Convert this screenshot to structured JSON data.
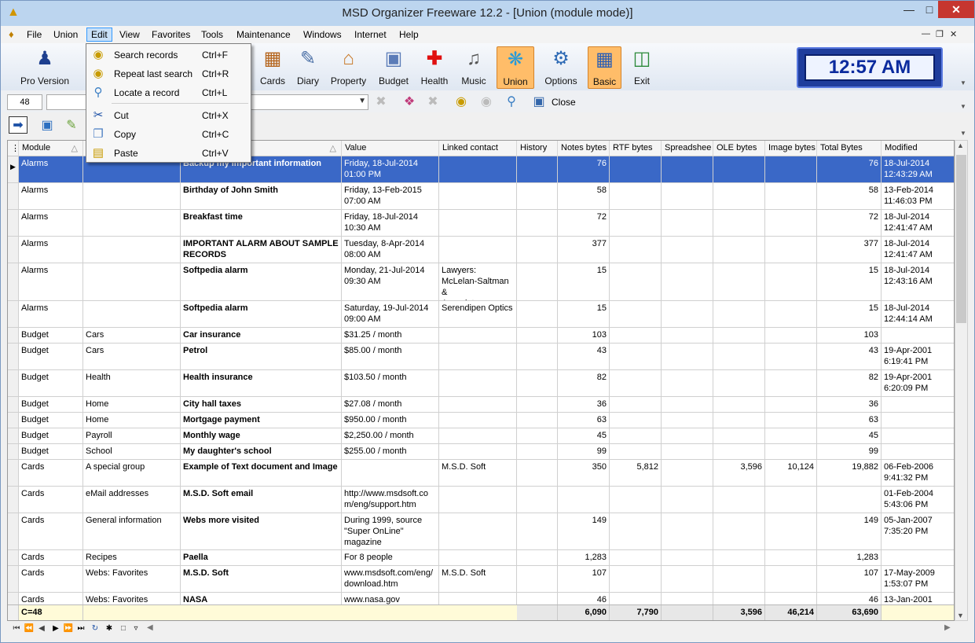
{
  "window": {
    "title": "MSD Organizer Freeware 12.2 - [Union (module mode)]"
  },
  "menu": [
    "File",
    "Union",
    "Edit",
    "View",
    "Favorites",
    "Tools",
    "Maintenance",
    "Windows",
    "Internet",
    "Help"
  ],
  "toolbar": {
    "buttons": [
      {
        "label": "Pro Version",
        "icon": "shield-person-icon"
      },
      {
        "label": "Cards",
        "icon": "cards-icon"
      },
      {
        "label": "Diary",
        "icon": "diary-icon"
      },
      {
        "label": "Property",
        "icon": "house-icon"
      },
      {
        "label": "Budget",
        "icon": "calculator-icon"
      },
      {
        "label": "Health",
        "icon": "cross-icon"
      },
      {
        "label": "Music",
        "icon": "cd-icon"
      },
      {
        "label": "Union",
        "icon": "puzzle-icon"
      },
      {
        "label": "Options",
        "icon": "gear-icon"
      },
      {
        "label": "Basic",
        "icon": "window-icon"
      },
      {
        "label": "Exit",
        "icon": "door-icon"
      }
    ],
    "clock": "12:57 AM"
  },
  "searchbar": {
    "record_count": "48",
    "close_label": "Close"
  },
  "edit_menu": [
    {
      "label": "Search records",
      "shortcut": "Ctrl+F",
      "icon": "binoculars-icon"
    },
    {
      "label": "Repeat last search",
      "shortcut": "Ctrl+R",
      "icon": "binoculars-icon"
    },
    {
      "label": "Locate a record",
      "shortcut": "Ctrl+L",
      "icon": "magnifier-icon"
    },
    {
      "label": "Cut",
      "shortcut": "Ctrl+X",
      "icon": "scissors-icon"
    },
    {
      "label": "Copy",
      "shortcut": "Ctrl+C",
      "icon": "copy-icon"
    },
    {
      "label": "Paste",
      "shortcut": "Ctrl+V",
      "icon": "paste-icon"
    }
  ],
  "grid": {
    "columns": [
      "Module",
      "",
      "",
      "Value",
      "Linked contact",
      "History",
      "Notes bytes",
      "RTF bytes",
      "Spreadshee",
      "OLE bytes",
      "Image bytes",
      "Total Bytes",
      "Modified"
    ],
    "rows": [
      {
        "module": "Alarms",
        "group": "",
        "title": "Backup my important information",
        "value": "Friday, 18-Jul-2014\n01:00 PM",
        "contact": "",
        "notes": "76",
        "rtf": "",
        "ole": "",
        "image": "",
        "total": "76",
        "modified": "18-Jul-2014\n12:43:29 AM"
      },
      {
        "module": "Alarms",
        "group": "",
        "title": "Birthday of John Smith",
        "value": "Friday, 13-Feb-2015\n07:00 AM",
        "contact": "",
        "notes": "58",
        "rtf": "",
        "ole": "",
        "image": "",
        "total": "58",
        "modified": "13-Feb-2014\n11:46:03 PM"
      },
      {
        "module": "Alarms",
        "group": "",
        "title": "Breakfast time",
        "value": "Friday, 18-Jul-2014\n10:30 AM",
        "contact": "",
        "notes": "72",
        "rtf": "",
        "ole": "",
        "image": "",
        "total": "72",
        "modified": "18-Jul-2014\n12:41:47 AM"
      },
      {
        "module": "Alarms",
        "group": "",
        "title": "IMPORTANT ALARM ABOUT SAMPLE RECORDS",
        "value": "Tuesday, 8-Apr-2014\n08:00 AM",
        "contact": "",
        "notes": "377",
        "rtf": "",
        "ole": "",
        "image": "",
        "total": "377",
        "modified": "18-Jul-2014\n12:41:47 AM"
      },
      {
        "module": "Alarms",
        "group": "",
        "title": "Softpedia alarm",
        "value": "Monday, 21-Jul-2014\n09:30 AM",
        "contact": "Lawyers:\nMcLelan-Saltman &\nAssociates",
        "notes": "15",
        "rtf": "",
        "ole": "",
        "image": "",
        "total": "15",
        "modified": "18-Jul-2014\n12:43:16 AM"
      },
      {
        "module": "Alarms",
        "group": "",
        "title": "Softpedia alarm",
        "value": "Saturday, 19-Jul-2014\n09:00 AM",
        "contact": "Serendipen Optics",
        "notes": "15",
        "rtf": "",
        "ole": "",
        "image": "",
        "total": "15",
        "modified": "18-Jul-2014\n12:44:14 AM"
      },
      {
        "module": "Budget",
        "group": "Cars",
        "title": "Car insurance",
        "value": "$31.25 / month",
        "contact": "",
        "notes": "103",
        "rtf": "",
        "ole": "",
        "image": "",
        "total": "103",
        "modified": ""
      },
      {
        "module": "Budget",
        "group": "Cars",
        "title": "Petrol",
        "value": "$85.00 / month",
        "contact": "",
        "notes": "43",
        "rtf": "",
        "ole": "",
        "image": "",
        "total": "43",
        "modified": "19-Apr-2001\n6:19:41 PM"
      },
      {
        "module": "Budget",
        "group": "Health",
        "title": "Health insurance",
        "value": "$103.50 / month",
        "contact": "",
        "notes": "82",
        "rtf": "",
        "ole": "",
        "image": "",
        "total": "82",
        "modified": "19-Apr-2001\n6:20:09 PM"
      },
      {
        "module": "Budget",
        "group": "Home",
        "title": "City hall taxes",
        "value": "$27.08 / month",
        "contact": "",
        "notes": "36",
        "rtf": "",
        "ole": "",
        "image": "",
        "total": "36",
        "modified": ""
      },
      {
        "module": "Budget",
        "group": "Home",
        "title": "Mortgage payment",
        "value": "$950.00 / month",
        "contact": "",
        "notes": "63",
        "rtf": "",
        "ole": "",
        "image": "",
        "total": "63",
        "modified": ""
      },
      {
        "module": "Budget",
        "group": "Payroll",
        "title": "Monthly wage",
        "value": "$2,250.00 / month",
        "contact": "",
        "notes": "45",
        "rtf": "",
        "ole": "",
        "image": "",
        "total": "45",
        "modified": ""
      },
      {
        "module": "Budget",
        "group": "School",
        "title": "My daughter's school",
        "value": "$255.00 / month",
        "contact": "",
        "notes": "99",
        "rtf": "",
        "ole": "",
        "image": "",
        "total": "99",
        "modified": ""
      },
      {
        "module": "Cards",
        "group": "A special group",
        "title": "Example of Text document and Image",
        "value": "",
        "contact": "M.S.D. Soft",
        "notes": "350",
        "rtf": "5,812",
        "ole": "3,596",
        "image": "10,124",
        "total": "19,882",
        "modified": "06-Feb-2006\n9:41:32 PM"
      },
      {
        "module": "Cards",
        "group": "eMail addresses",
        "title": "M.S.D. Soft email",
        "value": "http://www.msdsoft.co\nm/eng/support.htm",
        "contact": "",
        "notes": "",
        "rtf": "",
        "ole": "",
        "image": "",
        "total": "",
        "modified": "01-Feb-2004\n5:43:06 PM"
      },
      {
        "module": "Cards",
        "group": "General information",
        "title": "Webs more visited",
        "value": "During 1999, source\n\"Super OnLine\"\nmagazine",
        "contact": "",
        "notes": "149",
        "rtf": "",
        "ole": "",
        "image": "",
        "total": "149",
        "modified": "05-Jan-2007\n7:35:20 PM"
      },
      {
        "module": "Cards",
        "group": "Recipes",
        "title": "Paella",
        "value": "For 8 people",
        "contact": "",
        "notes": "1,283",
        "rtf": "",
        "ole": "",
        "image": "",
        "total": "1,283",
        "modified": ""
      },
      {
        "module": "Cards",
        "group": "Webs: Favorites",
        "title": "M.S.D. Soft",
        "value": "www.msdsoft.com/eng/\ndownload.htm",
        "contact": "M.S.D. Soft",
        "notes": "107",
        "rtf": "",
        "ole": "",
        "image": "",
        "total": "107",
        "modified": "17-May-2009\n1:53:07 PM"
      },
      {
        "module": "Cards",
        "group": "Webs: Favorites",
        "title": "NASA",
        "value": "www.nasa.gov",
        "contact": "",
        "notes": "46",
        "rtf": "",
        "ole": "",
        "image": "",
        "total": "46",
        "modified": "13-Jan-2001"
      }
    ],
    "footer": {
      "count": "C=48",
      "notes": "6,090",
      "rtf": "7,790",
      "ole": "3,596",
      "image": "46,214",
      "total": "63,690"
    }
  }
}
